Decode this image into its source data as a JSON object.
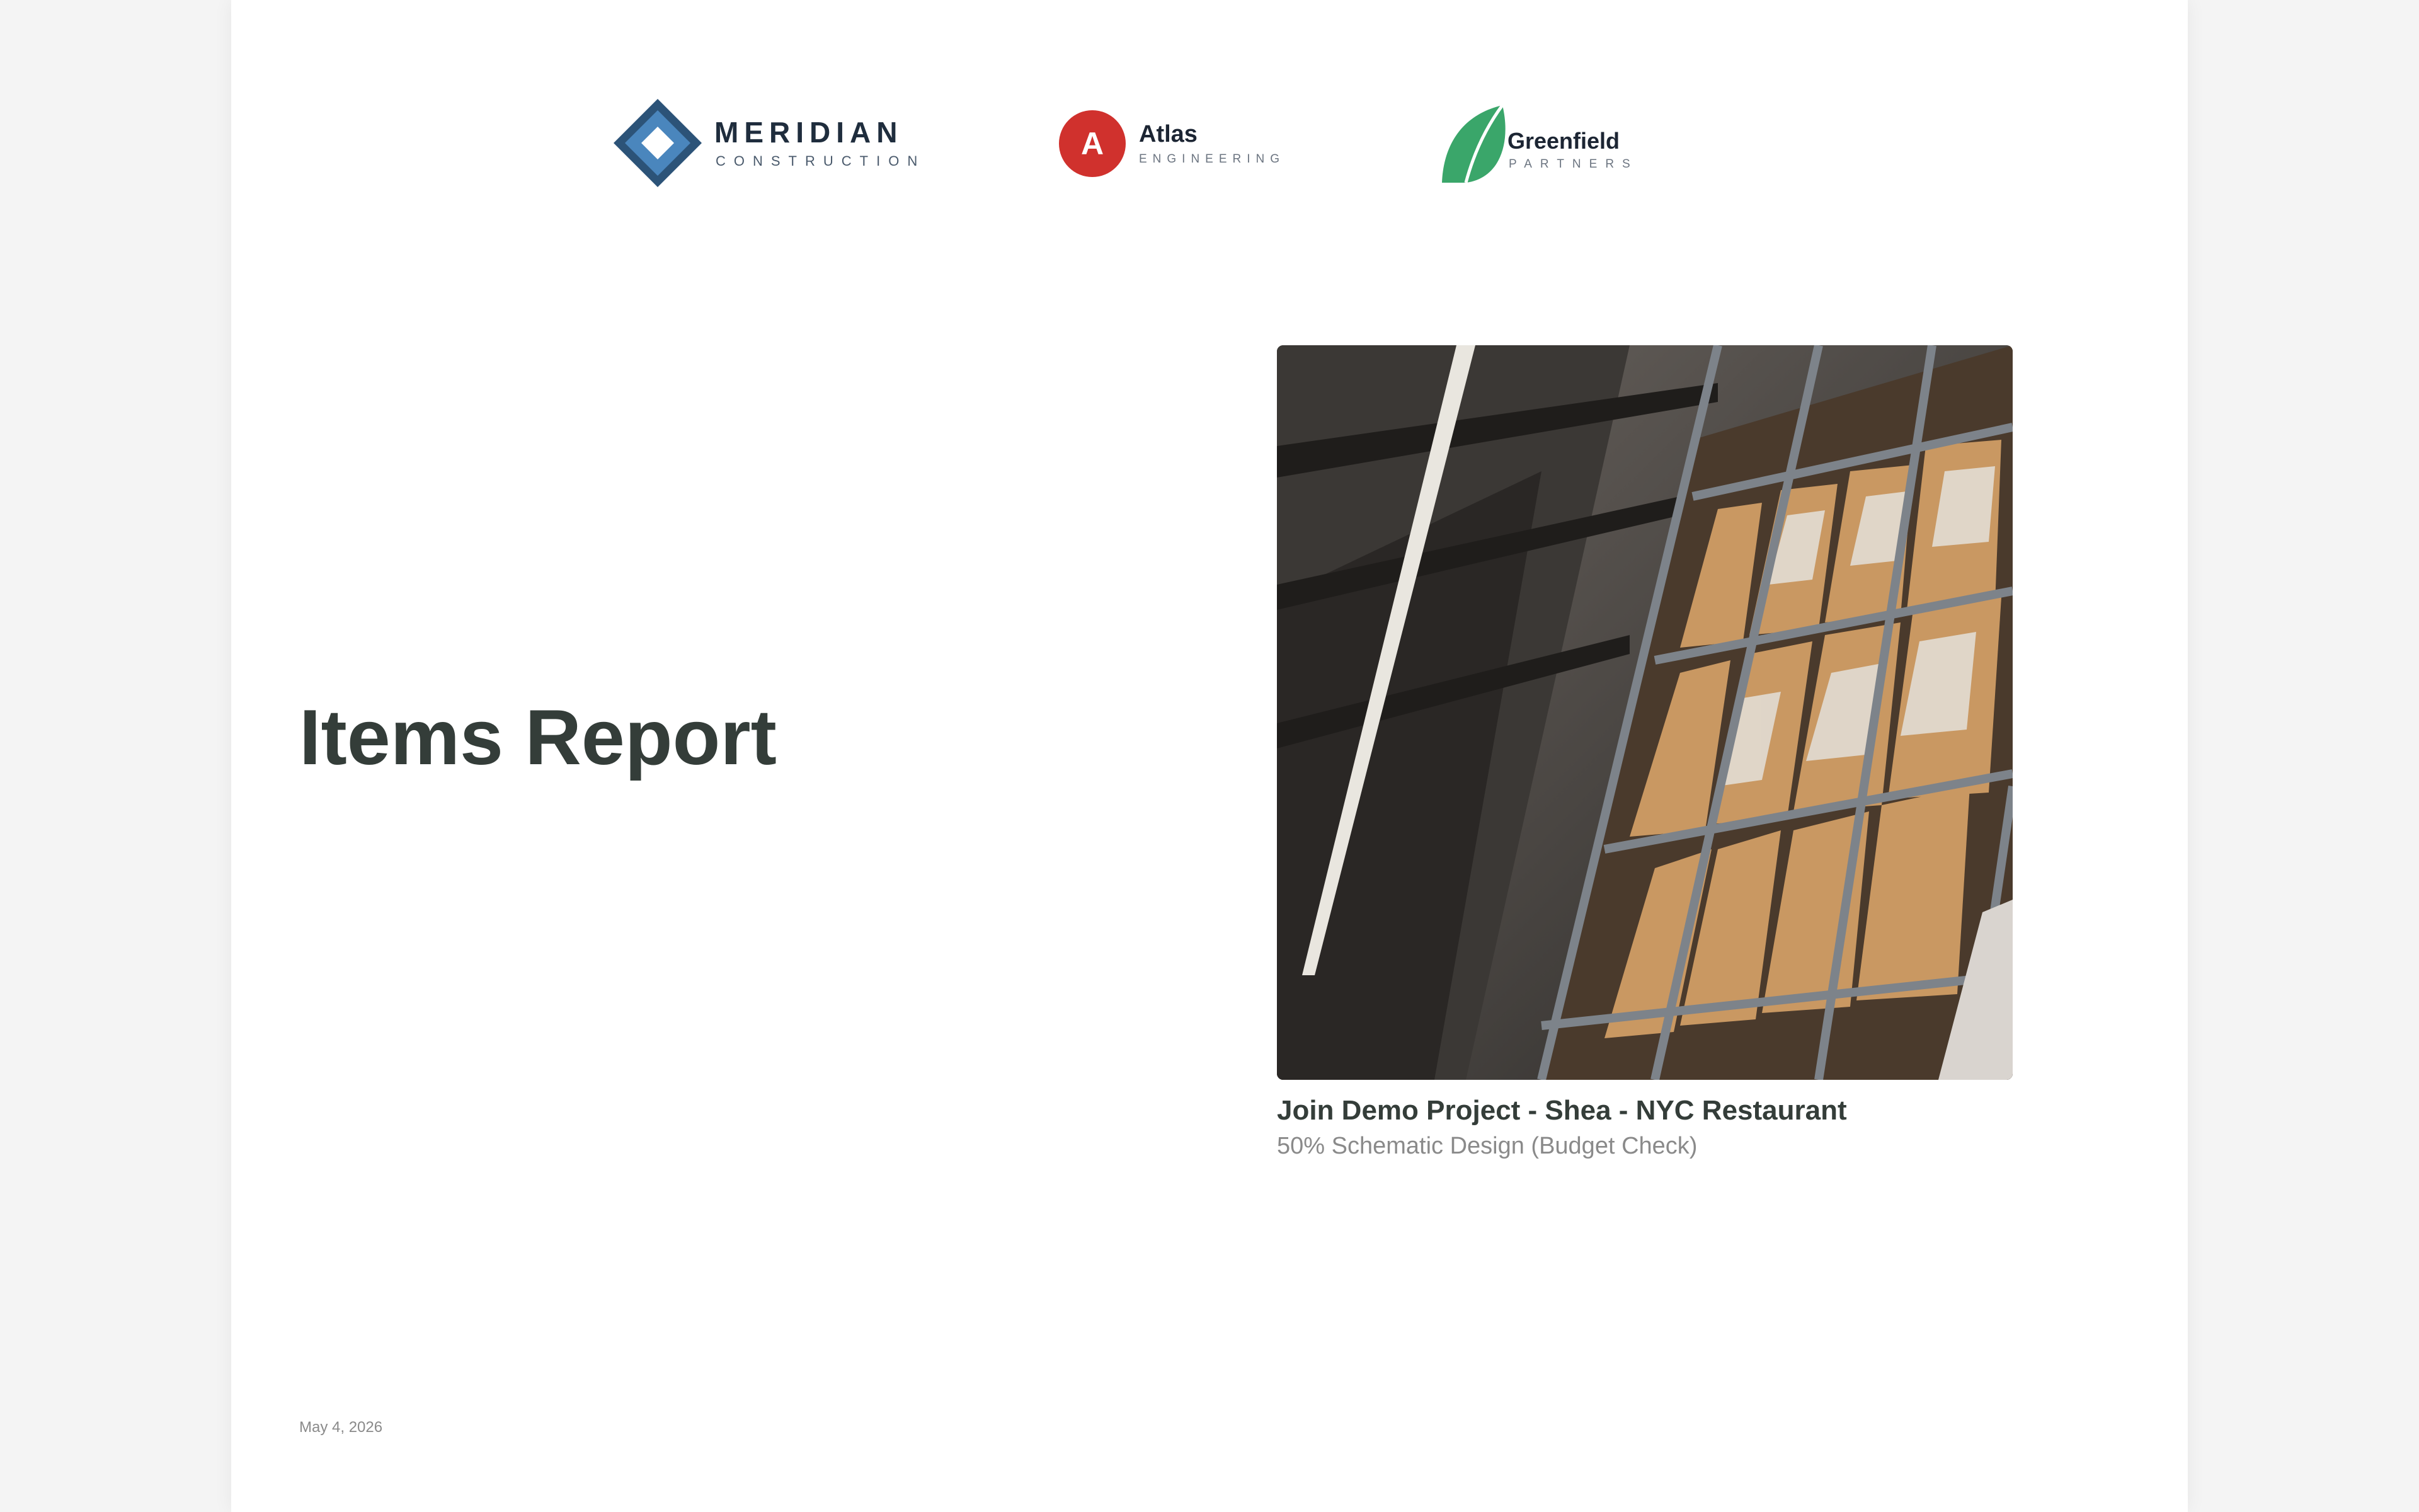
{
  "logos": [
    {
      "name": "MERIDIAN",
      "sub": "CONSTRUCTION",
      "icon": "diamond-icon",
      "color": "#2f5f8a"
    },
    {
      "name": "Atlas",
      "sub": "ENGINEERING",
      "monogram": "A",
      "color": "#d0312d"
    },
    {
      "name": "Greenfield",
      "sub": "PARTNERS",
      "icon": "leaf-icon",
      "color": "#3aa66a"
    }
  ],
  "report": {
    "title": "Items Report",
    "date": "May 4, 2026"
  },
  "project": {
    "image": "warehouse-shelves-photo",
    "name": "Join Demo Project - Shea - NYC Restaurant",
    "phase": "50% Schematic Design (Budget Check)"
  }
}
